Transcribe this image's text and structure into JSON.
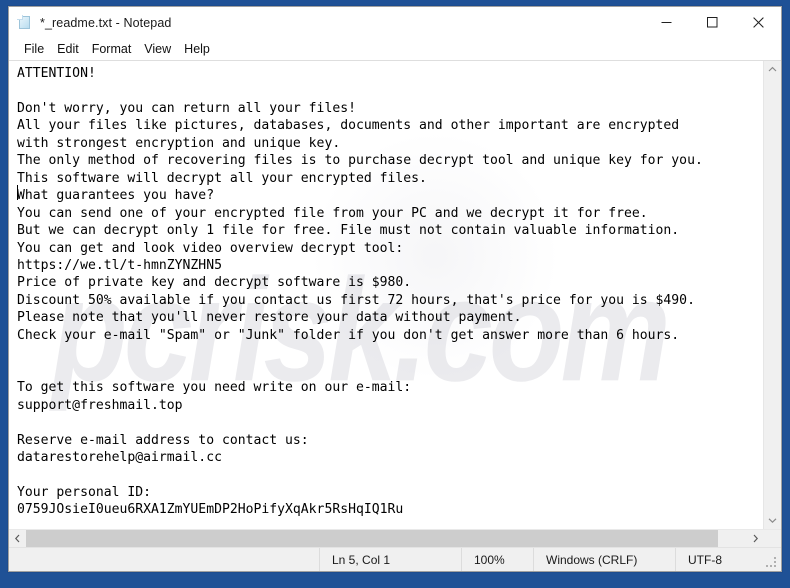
{
  "window": {
    "title": "*_readme.txt - Notepad",
    "icon": "notepad-document-icon",
    "minimize_label": "Minimize",
    "maximize_label": "Maximize",
    "close_label": "Close"
  },
  "menubar": {
    "items": [
      {
        "label": "File"
      },
      {
        "label": "Edit"
      },
      {
        "label": "Format"
      },
      {
        "label": "View"
      },
      {
        "label": "Help"
      }
    ]
  },
  "document": {
    "body": "ATTENTION!\n\nDon't worry, you can return all your files!\nAll your files like pictures, databases, documents and other important are encrypted\nwith strongest encryption and unique key.\nThe only method of recovering files is to purchase decrypt tool and unique key for you.\nThis software will decrypt all your encrypted files.\nWhat guarantees you have?\nYou can send one of your encrypted file from your PC and we decrypt it for free.\nBut we can decrypt only 1 file for free. File must not contain valuable information.\nYou can get and look video overview decrypt tool:\nhttps://we.tl/t-hmnZYNZHN5\nPrice of private key and decrypt software is $980.\nDiscount 50% available if you contact us first 72 hours, that's price for you is $490.\nPlease note that you'll never restore your data without payment.\nCheck your e-mail \"Spam\" or \"Junk\" folder if you don't get answer more than 6 hours.\n\n\nTo get this software you need write on our e-mail:\nsupport@freshmail.top\n\nReserve e-mail address to contact us:\ndatarestorehelp@airmail.cc\n\nYour personal ID:\n0759JOsieI0ueu6RXA1ZmYUEmDP2HoPifyXqAkr5RsHqIQ1Ru",
    "lines": [
      "ATTENTION!",
      "",
      "Don't worry, you can return all your files!",
      "All your files like pictures, databases, documents and other important are encrypted",
      "with strongest encryption and unique key.",
      "The only method of recovering files is to purchase decrypt tool and unique key for you.",
      "This software will decrypt all your encrypted files.",
      "What guarantees you have?",
      "You can send one of your encrypted file from your PC and we decrypt it for free.",
      "But we can decrypt only 1 file for free. File must not contain valuable information.",
      "You can get and look video overview decrypt tool:",
      "https://we.tl/t-hmnZYNZHN5",
      "Price of private key and decrypt software is $980.",
      "Discount 50% available if you contact us first 72 hours, that's price for you is $490.",
      "Please note that you'll never restore your data without payment.",
      "Check your e-mail \"Spam\" or \"Junk\" folder if you don't get answer more than 6 hours.",
      "",
      "",
      "To get this software you need write on our e-mail:",
      "support@freshmail.top",
      "",
      "Reserve e-mail address to contact us:",
      "datarestorehelp@airmail.cc",
      "",
      "Your personal ID:",
      "0759JOsieI0ueu6RXA1ZmYUEmDP2HoPifyXqAkr5RsHqIQ1Ru"
    ],
    "ransom_details": {
      "video_url": "https://we.tl/t-hmnZYNZHN5",
      "full_price": "$980",
      "discount_price": "$490",
      "discount_percent": "50%",
      "discount_window": "72 hours",
      "response_time": "6 hours",
      "primary_email": "support@freshmail.top",
      "reserve_email": "datarestorehelp@airmail.cc",
      "personal_id": "0759JOsieI0ueu6RXA1ZmYUEmDP2HoPifyXqAkr5RsHqIQ1Ru"
    }
  },
  "watermark": {
    "text": "pcrisk.com"
  },
  "statusbar": {
    "line_col": "Ln 5, Col 1",
    "zoom": "100%",
    "line_ending": "Windows (CRLF)",
    "encoding": "UTF-8"
  },
  "scrollbars": {
    "vertical_up": "scroll-up",
    "vertical_down": "scroll-down",
    "horizontal_left": "scroll-left",
    "horizontal_right": "scroll-right"
  },
  "colors": {
    "desktop": "#1f5196",
    "window_bg": "#ffffff",
    "statusbar_bg": "#f0f0f0",
    "scroll_thumb": "#cdcdcd",
    "text": "#000000"
  }
}
